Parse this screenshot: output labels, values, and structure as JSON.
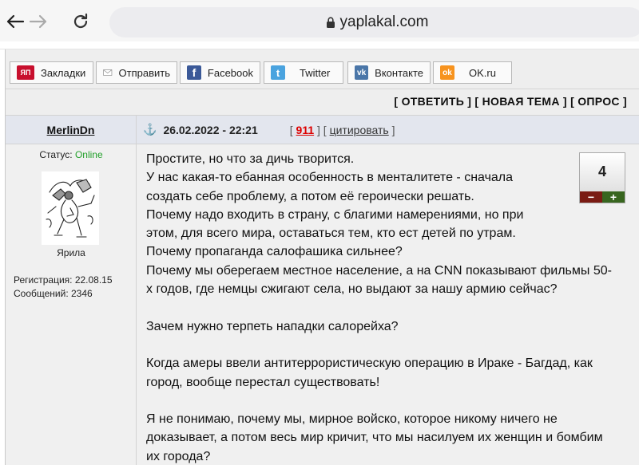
{
  "browser": {
    "url": "yaplakal.com"
  },
  "share": {
    "items": [
      {
        "label": "Закладки",
        "icon": "yap-bookmark-icon",
        "icon_text": "ЯП",
        "color": "#c8102e"
      },
      {
        "label": "Отправить",
        "icon": "envelope-icon",
        "icon_text": "",
        "color": "#6d6d6d"
      },
      {
        "label": "Facebook",
        "icon": "facebook-icon",
        "icon_text": "f",
        "color": "#3b5998"
      },
      {
        "label": "Twitter",
        "icon": "twitter-icon",
        "icon_text": "t",
        "color": "#4aa3df"
      },
      {
        "label": "Вконтакте",
        "icon": "vk-icon",
        "icon_text": "vk",
        "color": "#4a76a8"
      },
      {
        "label": "OK.ru",
        "icon": "ok-icon",
        "icon_text": "ok",
        "color": "#f7931e"
      }
    ]
  },
  "actions": {
    "reply": "ОТВЕТИТЬ",
    "new_topic": "НОВАЯ ТЕМА",
    "poll": "ОПРОС"
  },
  "post": {
    "author": "MerlinDn",
    "date": "26.02.2022 - 22:21",
    "number": "911",
    "quote_label": "цитировать",
    "status_label": "Статус:",
    "status_value": "Online",
    "rank": "Ярила",
    "registration": "Регистрация: 22.08.15",
    "messages": "Сообщений: 2346",
    "rating": "4",
    "rating_minus": "−",
    "rating_plus": "+",
    "text_lines": [
      "Простите, но что за дичь творится.",
      "У нас какая-то ебанная особенность в менталитете - сначала",
      "создать себе проблему, а потом её героически решать.",
      "Почему надо входить в страну, с благими намерениями, но при",
      "этом, для всего мира, оставаться тем, кто ест детей по утрам.",
      "Почему пропаганда салофашика сильнее?",
      "Почему мы оберегаем местное население, а на CNN показывают фильмы 50-",
      "х годов, где немцы сжигают села, но выдают за нашу армию сейчас?",
      "",
      "Зачем нужно терпеть нападки салорейха?",
      "",
      "Когда амеры ввели антитеррористическую операцию в Ираке - Багдад, как",
      "город, вообще перестал существовать!",
      "",
      "Я не понимаю, почему мы, мирное войско, которое никому ничего не",
      "доказывает, а потом весь мир кричит, что мы насилуем их женщин и бомбим",
      "их города?"
    ]
  }
}
